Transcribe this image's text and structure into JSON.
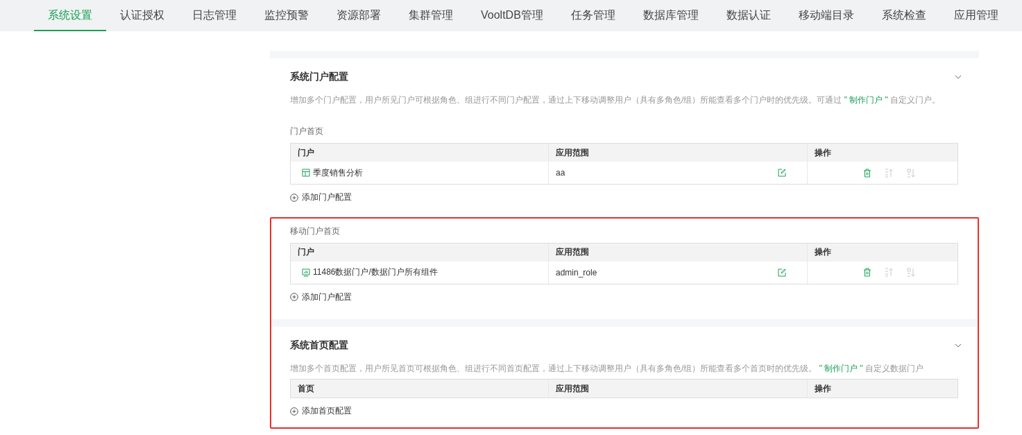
{
  "nav": {
    "tabs": [
      {
        "label": "系统设置",
        "selected": true
      },
      {
        "label": "认证授权",
        "selected": false
      },
      {
        "label": "日志管理",
        "selected": false
      },
      {
        "label": "监控预警",
        "selected": false
      },
      {
        "label": "资源部署",
        "selected": false
      },
      {
        "label": "集群管理",
        "selected": false
      },
      {
        "label": "VooltDB管理",
        "selected": false
      },
      {
        "label": "任务管理",
        "selected": false
      },
      {
        "label": "数据库管理",
        "selected": false
      },
      {
        "label": "数据认证",
        "selected": false
      },
      {
        "label": "移动端目录",
        "selected": false
      },
      {
        "label": "系统检查",
        "selected": false
      },
      {
        "label": "应用管理",
        "selected": false
      }
    ]
  },
  "sections": [
    {
      "title": "系统门户配置",
      "expanded": true,
      "description": {
        "before": "增加多个门户配置，用户所见门户可根据角色、组进行不同门户配置，通过上下移动调整用户（具有多角色/组）所能查看多个门户时的优先级。可通过 ",
        "link": "\" 制作门户 \"",
        "after": " 自定义门户。"
      },
      "groups": [
        {
          "label": "门户首页",
          "columns": [
            "门户",
            "应用范围",
            "操作"
          ],
          "rows": [
            {
              "kind": "dashboard",
              "name": "季度销售分析",
              "scope": "aa",
              "actions": [
                {
                  "kind": "delete",
                  "disabled": false
                },
                {
                  "kind": "move-up",
                  "disabled": true
                },
                {
                  "kind": "move-down",
                  "disabled": true
                }
              ]
            }
          ],
          "add_label": "添加门户配置"
        },
        {
          "label": "移动门户首页",
          "columns": [
            "门户",
            "应用范围",
            "操作"
          ],
          "rows": [
            {
              "kind": "chart",
              "name": "11486数据门户/数据门户所有组件",
              "scope": "admin_role",
              "actions": [
                {
                  "kind": "delete",
                  "disabled": false
                },
                {
                  "kind": "move-up",
                  "disabled": true
                },
                {
                  "kind": "move-down",
                  "disabled": true
                }
              ]
            }
          ],
          "add_label": "添加门户配置"
        }
      ]
    },
    {
      "title": "系统首页配置",
      "expanded": true,
      "description": {
        "before": "增加多个首页配置，用户所见首页可根据角色、组进行不同首页配置，通过上下移动调整用户（具有多角色/组）所能查看多个首页时的优先级。 ",
        "link": "\" 制作门户 \"",
        "after": " 自定义数据门户"
      },
      "groups": [
        {
          "columns": [
            "首页",
            "应用范围",
            "操作"
          ],
          "add_label": "添加首页配置"
        }
      ]
    }
  ]
}
